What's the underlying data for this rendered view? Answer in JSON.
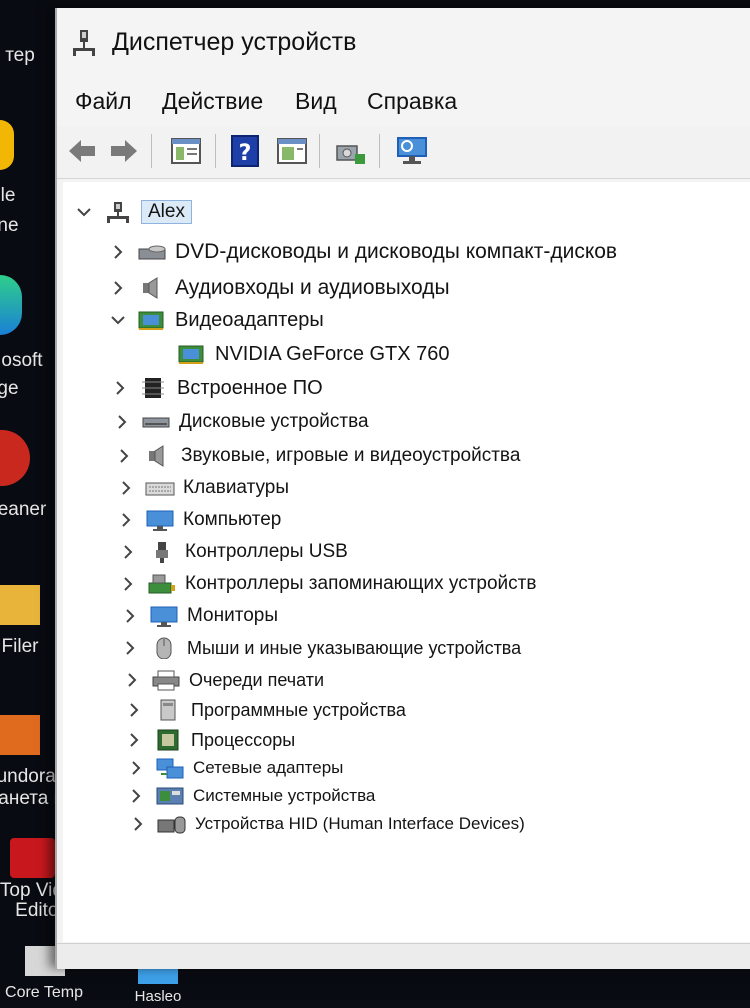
{
  "desktop": {
    "icons": [
      {
        "label": "тер"
      },
      {
        "label": "le"
      },
      {
        "label": "ne"
      },
      {
        "label": "osoft"
      },
      {
        "label": "ge"
      },
      {
        "label": "eaner"
      },
      {
        "label": "Filer"
      },
      {
        "label": "undora -"
      },
      {
        "label": "анета игр"
      },
      {
        "label": "Top Video"
      },
      {
        "label": "Editor"
      },
      {
        "label": "Core Temp"
      },
      {
        "label": "Hasleo"
      }
    ]
  },
  "window": {
    "title": "Диспетчер устройств"
  },
  "menu": {
    "items": [
      {
        "label": "Файл"
      },
      {
        "label": "Действие"
      },
      {
        "label": "Вид"
      },
      {
        "label": "Справка"
      }
    ]
  },
  "toolbar": {
    "buttons": [
      {
        "icon": "back-arrow-icon"
      },
      {
        "icon": "forward-arrow-icon"
      },
      {
        "icon": "show-hide-console-tree-icon"
      },
      {
        "icon": "help-icon"
      },
      {
        "icon": "properties-icon"
      },
      {
        "icon": "scan-hardware-icon"
      },
      {
        "icon": "monitor-display-icon"
      }
    ]
  },
  "tree": {
    "root": {
      "label": "Alex",
      "expanded": true
    },
    "categories": [
      {
        "label": "DVD-дисководы и дисководы компакт-дисков",
        "icon": "dvd-drive-icon",
        "expanded": false
      },
      {
        "label": "Аудиовходы и аудиовыходы",
        "icon": "speaker-icon",
        "expanded": false
      },
      {
        "label": "Видеоадаптеры",
        "icon": "display-adapter-icon",
        "expanded": true
      },
      {
        "label": "NVIDIA GeForce GTX 760",
        "icon": "display-adapter-icon",
        "child": true
      },
      {
        "label": "Встроенное ПО",
        "icon": "firmware-chip-icon",
        "expanded": false
      },
      {
        "label": "Дисковые устройства",
        "icon": "disk-drive-icon",
        "expanded": false
      },
      {
        "label": "Звуковые, игровые и видеоустройства",
        "icon": "speaker-icon",
        "expanded": false
      },
      {
        "label": "Клавиатуры",
        "icon": "keyboard-icon",
        "expanded": false
      },
      {
        "label": "Компьютер",
        "icon": "computer-icon",
        "expanded": false
      },
      {
        "label": "Контроллеры USB",
        "icon": "usb-icon",
        "expanded": false
      },
      {
        "label": "Контроллеры запоминающих устройств",
        "icon": "storage-controller-icon",
        "expanded": false
      },
      {
        "label": "Мониторы",
        "icon": "monitor-icon",
        "expanded": false
      },
      {
        "label": "Мыши и иные указывающие устройства",
        "icon": "mouse-icon",
        "expanded": false
      },
      {
        "label": "Очереди печати",
        "icon": "printer-icon",
        "expanded": false
      },
      {
        "label": "Программные устройства",
        "icon": "software-device-icon",
        "expanded": false
      },
      {
        "label": "Процессоры",
        "icon": "processor-icon",
        "expanded": false
      },
      {
        "label": "Сетевые адаптеры",
        "icon": "network-adapter-icon",
        "expanded": false
      },
      {
        "label": "Системные устройства",
        "icon": "system-device-icon",
        "expanded": false
      },
      {
        "label": "Устройства HID (Human Interface Devices)",
        "icon": "hid-icon",
        "expanded": false
      }
    ]
  },
  "colors": {
    "accent": "#1f5fb8",
    "selection": "#dce9f7",
    "window_bg": "#f3f3f3",
    "tree_bg": "#ffffff"
  }
}
